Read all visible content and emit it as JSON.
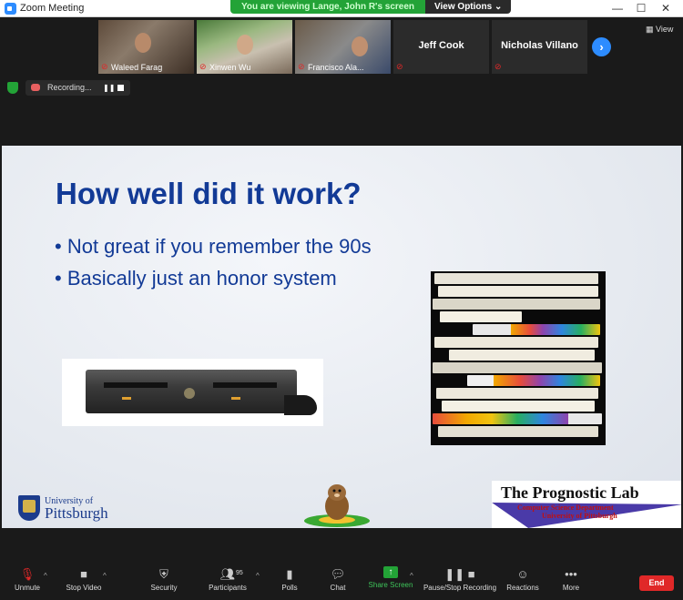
{
  "window": {
    "title": "Zoom Meeting"
  },
  "banner": {
    "message": "You are viewing Lange, John R's screen",
    "options": "View Options ⌄"
  },
  "window_controls": {
    "minimize": "—",
    "maximize": "☐",
    "close": "✕"
  },
  "participants": [
    {
      "name": "Waleed Farag",
      "video": true
    },
    {
      "name": "Xinwen Wu",
      "video": true
    },
    {
      "name": "Francisco Ala...",
      "video": true
    },
    {
      "name": "Jeff Cook",
      "video": false
    },
    {
      "name": "Nicholas Villano",
      "video": false
    }
  ],
  "next_page_icon": "›",
  "view_button": {
    "icon": "grid-icon",
    "label": "View"
  },
  "recording": {
    "label": "Recording...",
    "pause_icon": "❚❚",
    "stop_icon": "stop-icon"
  },
  "slide": {
    "title": "How well did it work?",
    "bullets": [
      "Not great if you remember the 90s",
      "Basically just an honor system"
    ],
    "university_small": "University of",
    "university_big": "Pittsburgh",
    "lab_title": "The Prognostic Lab",
    "lab_dept": "Computer Science Department",
    "lab_univ": "University of Pittsburgh"
  },
  "toolbar": {
    "unmute": "Unmute",
    "stop_video": "Stop Video",
    "security": "Security",
    "participants": "Participants",
    "participants_count": "95",
    "polls": "Polls",
    "chat": "Chat",
    "share_screen": "Share Screen",
    "pause_stop_recording": "Pause/Stop Recording",
    "reactions": "Reactions",
    "more": "More",
    "end": "End"
  },
  "colors": {
    "accent": "#2d8cff",
    "share_green": "#23a337",
    "end_red": "#e02828",
    "slide_title": "#123a96"
  }
}
